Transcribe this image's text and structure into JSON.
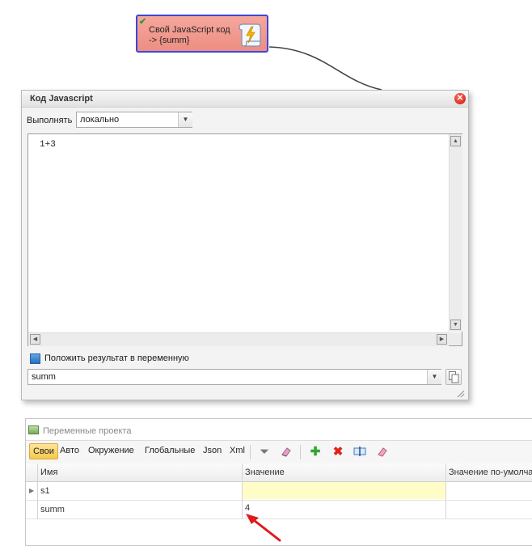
{
  "node": {
    "line1": "Свой JavaScript код",
    "line2": "-> {summ}",
    "check_glyph": "✔",
    "icon": "scroll-lightning-icon"
  },
  "dialog": {
    "title": "Код Javascript",
    "close_icon": "close-icon",
    "execute_label": "Выполнять",
    "execute_value": "локально",
    "code": "1+3",
    "save_result_label": "Положить результат в переменную",
    "variable_value": "summ"
  },
  "panel": {
    "title": "Переменные проекта",
    "tabs": [
      "Свои",
      "Авто",
      "Окружение",
      "Глобальные",
      "Json",
      "Xml"
    ],
    "active_tab": "Свои",
    "toolbar_icons": [
      "filter-icon",
      "eraser-icon",
      "add-icon",
      "delete-icon",
      "edit-icon",
      "clear-icon"
    ],
    "columns": [
      "Имя",
      "Значение",
      "Значение по-умолча"
    ],
    "rows": [
      {
        "name": "s1",
        "value": ""
      },
      {
        "name": "summ",
        "value": "4"
      }
    ]
  },
  "colors": {
    "node_fill": "#f09a8f",
    "node_border": "#3d46d8",
    "active_tab": "#f7c84d",
    "arrow": "#e01a1a",
    "highlight_cell": "#fefdc8"
  }
}
